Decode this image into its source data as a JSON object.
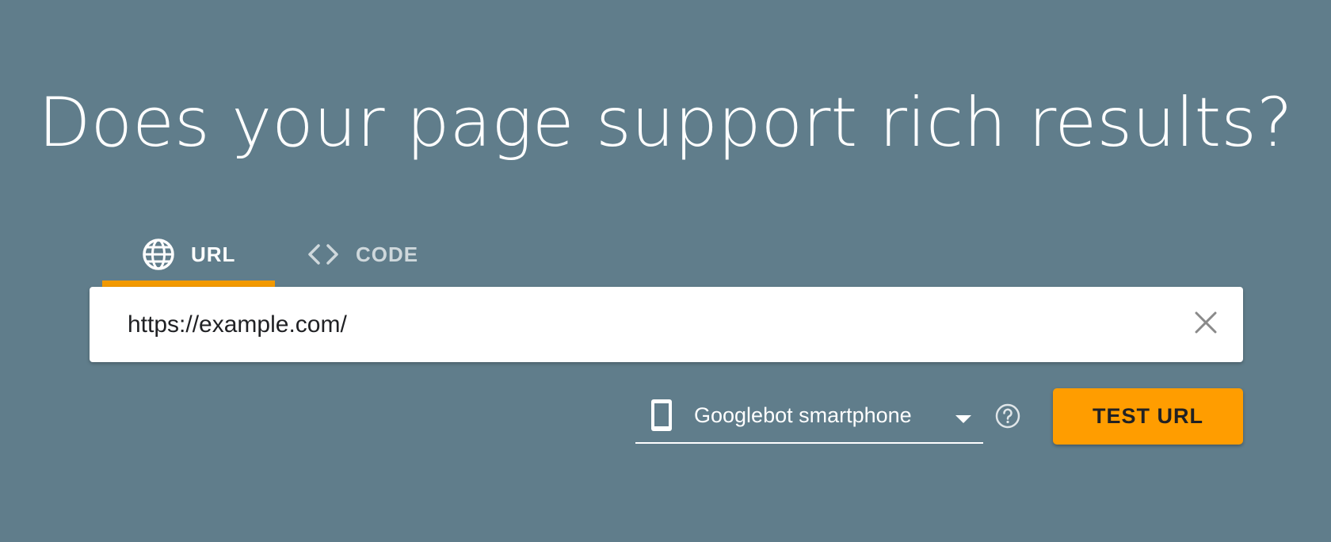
{
  "headline": "Does your page support rich results?",
  "tabs": [
    {
      "label": "URL",
      "icon": "globe-icon",
      "active": true
    },
    {
      "label": "CODE",
      "icon": "code-brackets-icon",
      "active": false
    }
  ],
  "url_input": {
    "value": "https://example.com/",
    "clear_icon": "close-icon"
  },
  "device_select": {
    "icon": "smartphone-icon",
    "selected": "Googlebot smartphone",
    "caret_icon": "dropdown-caret-icon"
  },
  "help_icon": "help-icon",
  "test_button": {
    "label": "TEST URL"
  },
  "colors": {
    "background": "#607d8b",
    "accent": "#f29900",
    "button": "#ff9d00",
    "text_dark": "#202124"
  }
}
